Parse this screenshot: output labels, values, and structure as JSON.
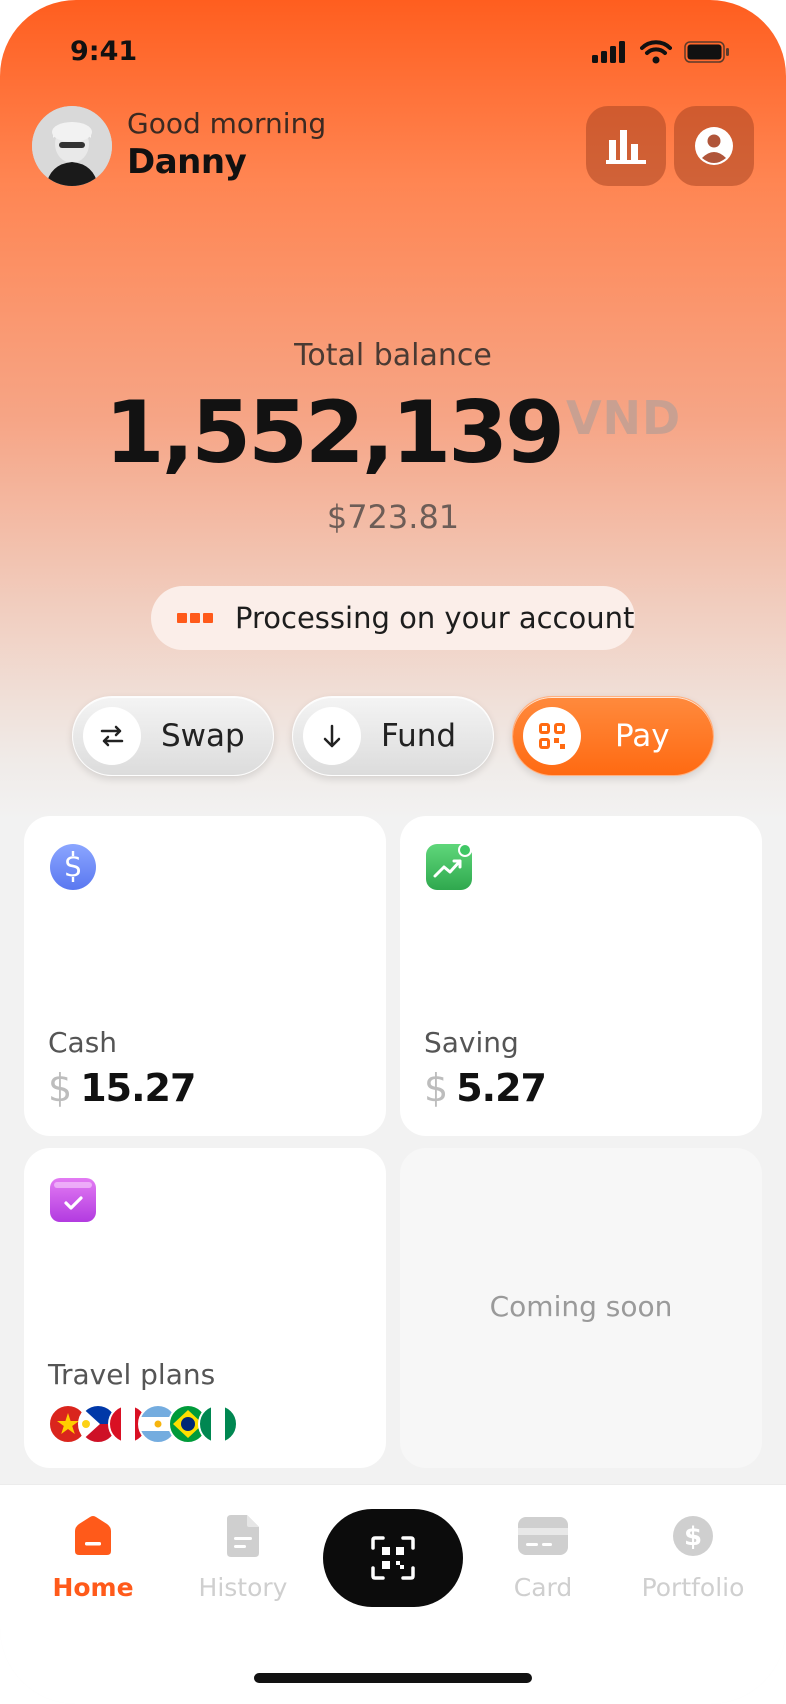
{
  "status_bar": {
    "time": "9:41",
    "icons": [
      "signal-icon",
      "wifi-icon",
      "battery-icon"
    ]
  },
  "header": {
    "greeting": "Good morning",
    "username": "Danny",
    "stats_icon": "bar-chart-icon",
    "profile_icon": "user-icon"
  },
  "balance": {
    "label": "Total balance",
    "amount": "1,552,139",
    "currency": "VND",
    "usd": "$723.81"
  },
  "processing": {
    "text": "Processing on your account"
  },
  "actions": {
    "swap": {
      "label": "Swap",
      "icon": "swap-arrows-icon"
    },
    "fund": {
      "label": "Fund",
      "icon": "arrow-down-icon"
    },
    "pay": {
      "label": "Pay",
      "icon": "qr-pay-icon"
    }
  },
  "cards": {
    "cash": {
      "title": "Cash",
      "currency": "$",
      "value": "15.27",
      "icon": "dollar-coin-icon"
    },
    "saving": {
      "title": "Saving",
      "currency": "$",
      "value": "5.27",
      "icon": "trend-up-icon"
    },
    "travel": {
      "title": "Travel plans",
      "icon": "calendar-check-icon",
      "flags": [
        "vietnam-flag-icon",
        "philippines-flag-icon",
        "peru-flag-icon",
        "argentina-flag-icon",
        "brazil-flag-icon",
        "nigeria-flag-icon"
      ]
    },
    "soon": {
      "text": "Coming soon"
    }
  },
  "tabbar": {
    "home": "Home",
    "history": "History",
    "card": "Card",
    "portfolio": "Portfolio",
    "scan_icon": "qr-scan-icon"
  },
  "colors": {
    "accent": "#ff5a1a",
    "dark": "#0c0c0c",
    "inactive": "#cfcfcf"
  }
}
